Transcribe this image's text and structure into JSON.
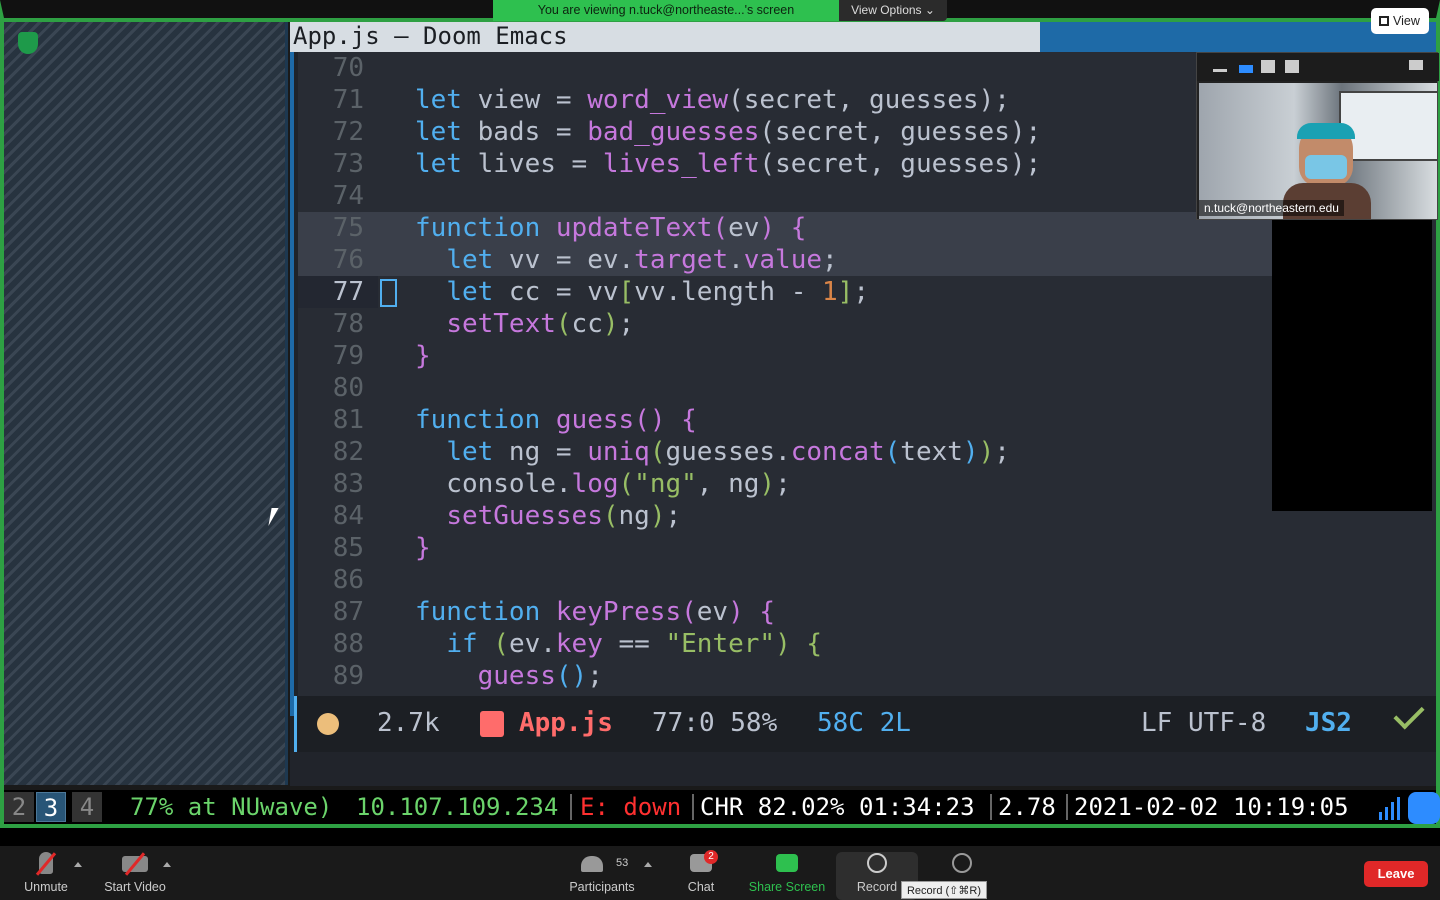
{
  "zoom": {
    "banner": "You are viewing n.tuck@northeaste...'s screen",
    "view_options": "View Options ⌄",
    "view_button": "View",
    "participant_name": "n.tuck@northeastern.edu",
    "toolbar": {
      "unmute": "Unmute",
      "start_video": "Start Video",
      "participants_label": "Participants",
      "participants_count": "53",
      "chat": "Chat",
      "chat_badge": "2",
      "share_screen": "Share Screen",
      "record": "Record",
      "record_tooltip": "Record (⇧⌘R)",
      "leave": "Leave"
    }
  },
  "emacs": {
    "title": "App.js — Doom Emacs",
    "lines": [
      {
        "n": "70"
      },
      {
        "n": "71"
      },
      {
        "n": "72"
      },
      {
        "n": "73"
      },
      {
        "n": "74"
      },
      {
        "n": "75"
      },
      {
        "n": "76"
      },
      {
        "n": "77"
      },
      {
        "n": "78"
      },
      {
        "n": "79"
      },
      {
        "n": "80"
      },
      {
        "n": "81"
      },
      {
        "n": "82"
      },
      {
        "n": "83"
      },
      {
        "n": "84"
      },
      {
        "n": "85"
      },
      {
        "n": "86"
      },
      {
        "n": "87"
      },
      {
        "n": "88"
      },
      {
        "n": "89"
      }
    ],
    "modeline": {
      "size": "2.7k",
      "filename": "App.js",
      "position": "77:0 58%",
      "selection": "58C 2L",
      "encoding": "LF UTF-8",
      "mode": "JS2"
    }
  },
  "statusbar": {
    "workspaces": [
      "2",
      "3",
      "4"
    ],
    "active_workspace": "3",
    "wifi": "77% at NUwave)",
    "ip": "10.107.109.234",
    "ethernet": "E: down",
    "battery": "CHR 82.02% 01:34:23",
    "load": "2.78",
    "datetime": "2021-02-02 10:19:05"
  },
  "colors": {
    "keyword": "#51afef",
    "function": "#c678dd",
    "string": "#98be65",
    "number": "#da8548",
    "share_border": "#2ea043",
    "leave": "#e02828"
  }
}
